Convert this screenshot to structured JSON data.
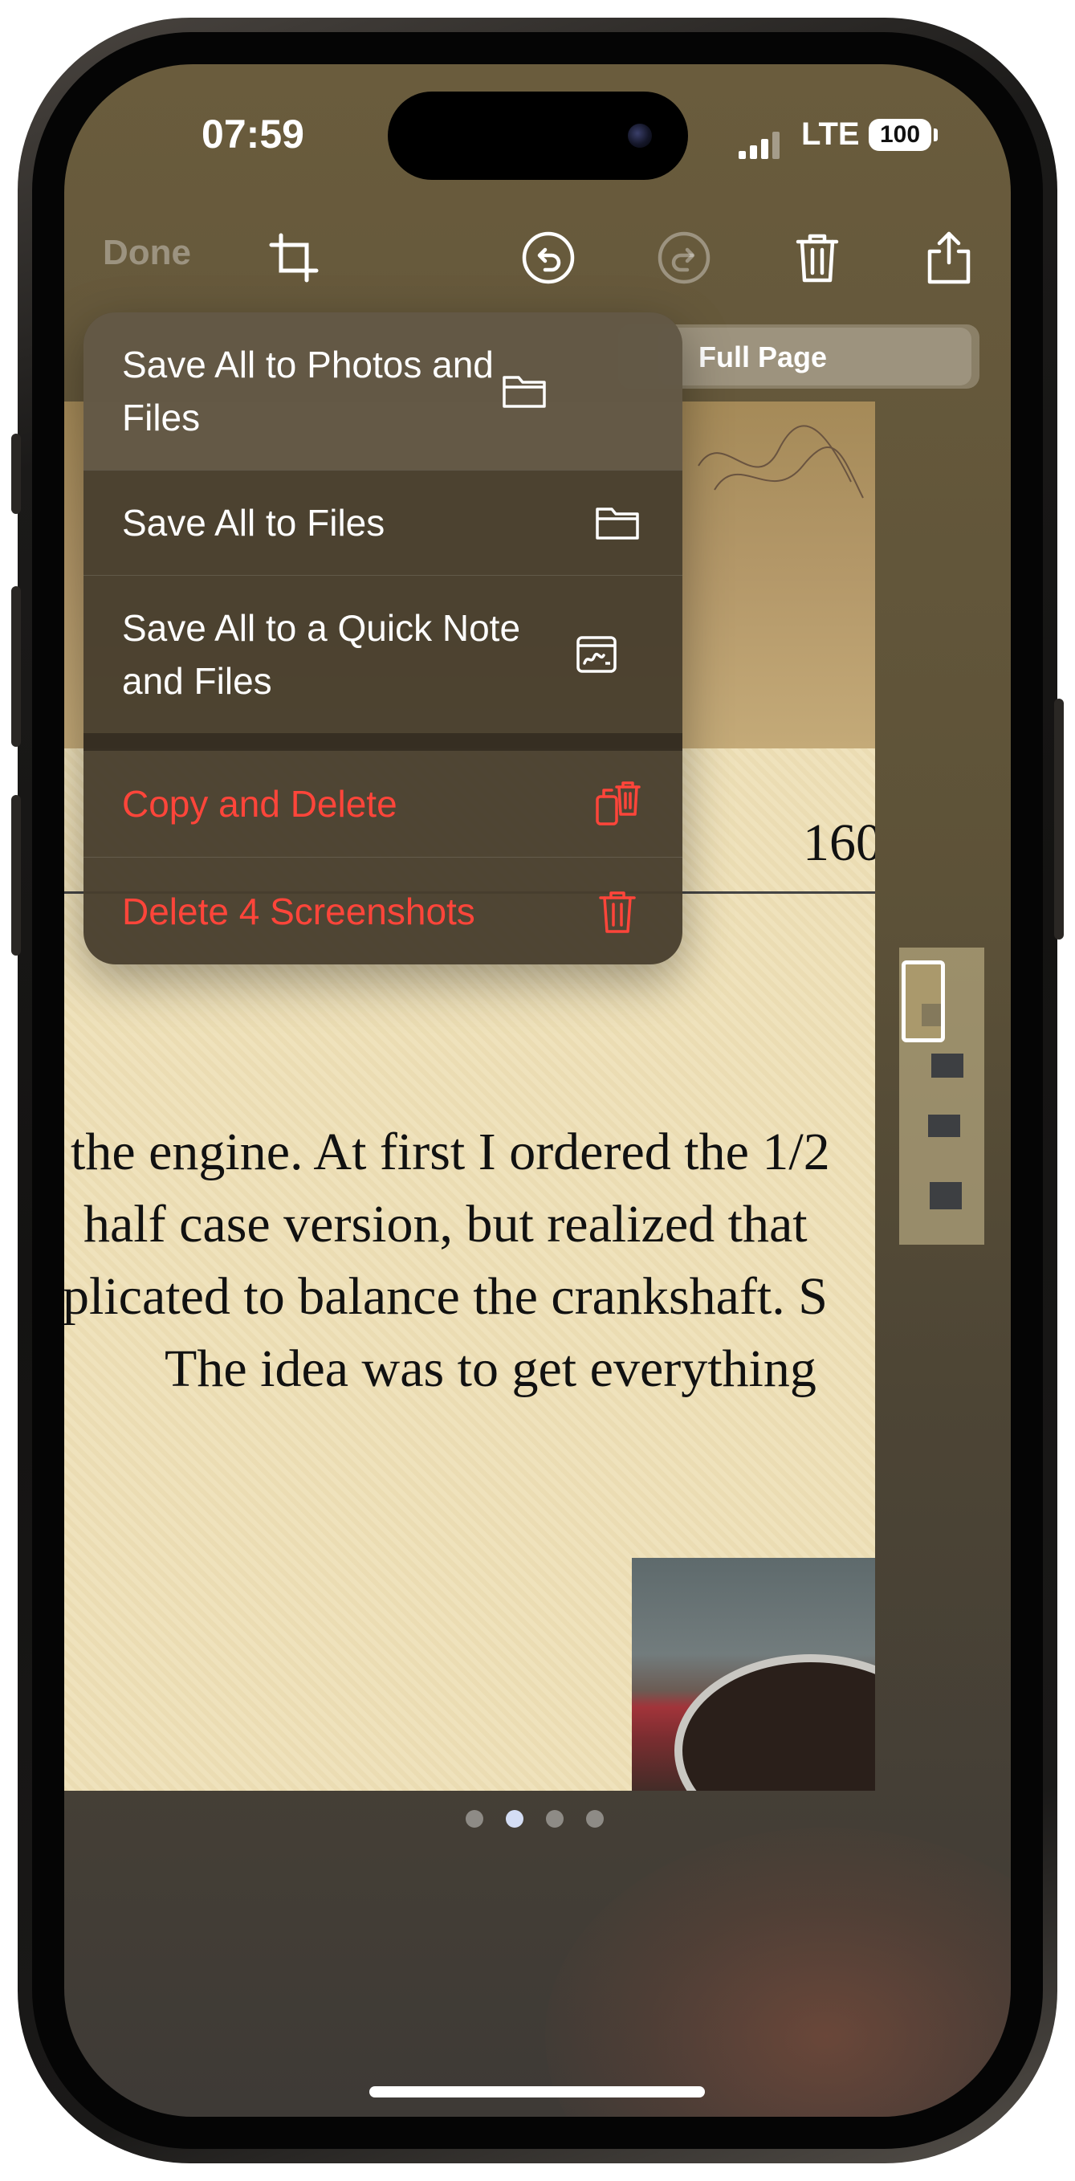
{
  "status_bar": {
    "time": "07:59",
    "network": "LTE",
    "battery": "100"
  },
  "toolbar": {
    "done_label": "Done"
  },
  "segmented": {
    "selected_label": "Full Page"
  },
  "document": {
    "page_number": "160",
    "lines": [
      "the engine. At first I ordered the 1/2",
      "half case version, but realized that",
      "plicated to balance the crankshaft. S",
      "The idea was to get everything"
    ]
  },
  "menu": {
    "items": [
      {
        "label": "Save All to Photos and Files",
        "icon": "folder-icon"
      },
      {
        "label": "Save All to Files",
        "icon": "folder-icon"
      },
      {
        "label": "Save All to a Quick Note and Files",
        "icon": "quick-note-icon"
      },
      {
        "label": "Copy and Delete",
        "icon": "copy-trash-icon",
        "destructive": true
      },
      {
        "label": "Delete 4 Screenshots",
        "icon": "trash-icon",
        "destructive": true
      }
    ]
  },
  "pager": {
    "count": 4,
    "active_index": 1
  },
  "colors": {
    "destructive": "#ff453a",
    "menu_background": "#483e2e"
  }
}
